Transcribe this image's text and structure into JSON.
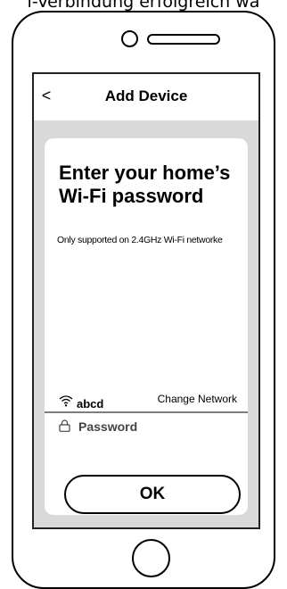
{
  "caption": "i-Verbindung erfolgreich wa",
  "topbar": {
    "back_icon": "chevron-left-icon",
    "back_glyph": "<",
    "title": "Add Device"
  },
  "card": {
    "heading_line1": "Enter your home’s",
    "heading_line2": "Wi-Fi password",
    "subtext": "Only supported on 2.4GHz Wi-Fi networke",
    "wifi_icon": "wifi-icon",
    "ssid": "abcd",
    "change_network": "Change Network",
    "lock_icon": "lock-icon",
    "password_placeholder": "Password",
    "password_value": "",
    "ok_label": "OK"
  },
  "colors": {
    "screen_background": "#d9d9d9",
    "card_background": "#ffffff",
    "divider": "#7d7d7d"
  }
}
